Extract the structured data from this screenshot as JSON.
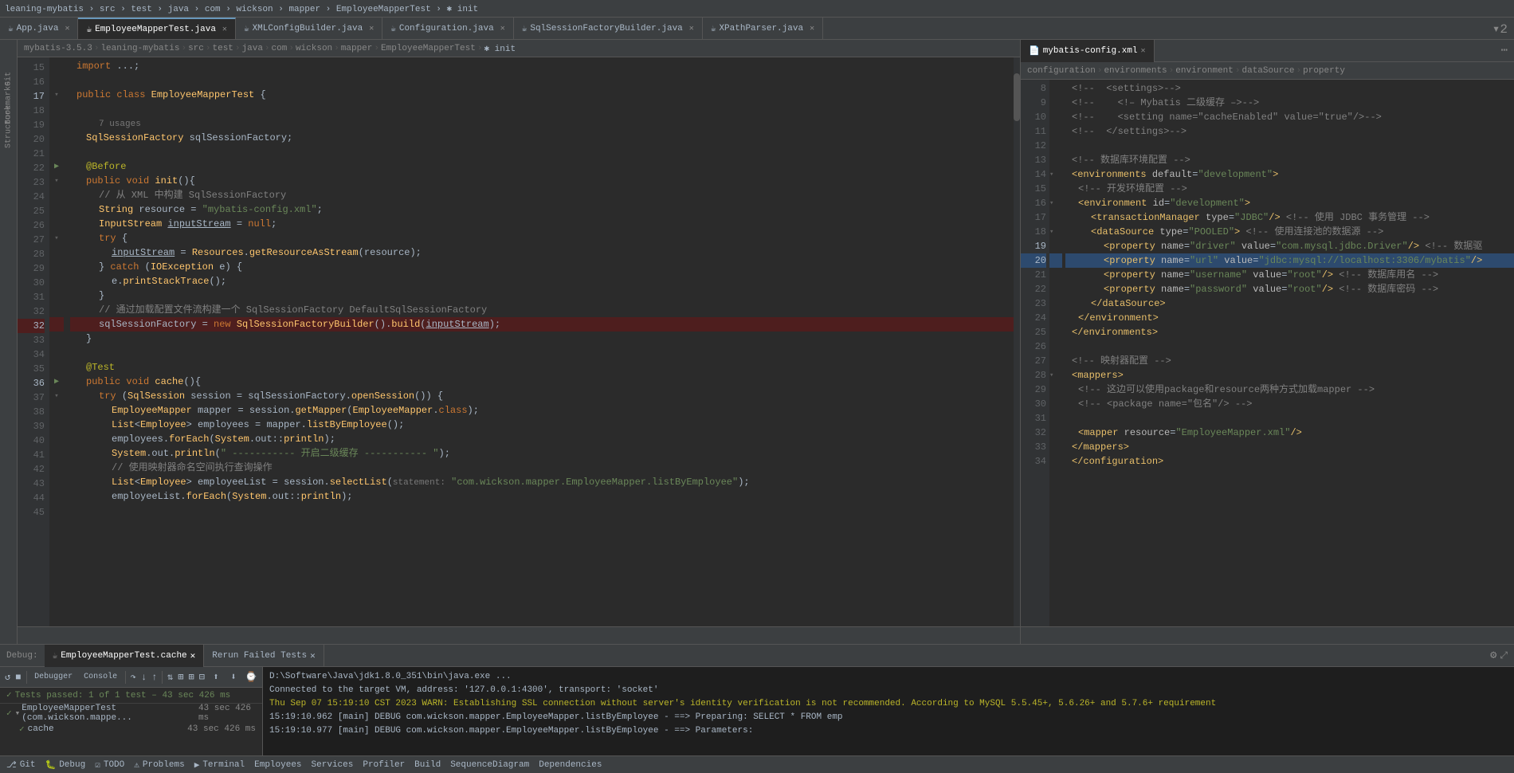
{
  "topbar": {
    "title": "leaning-mybatis",
    "project": "mybatis-3.5.3",
    "separator": "›",
    "path": "leaning-mybatis › src › test › java › com › wickson › mapper › EmployeeMapperTest › ✱ init"
  },
  "tabbar": {
    "tabs": [
      {
        "id": "app",
        "label": "App.java",
        "icon": "☕",
        "active": false
      },
      {
        "id": "employee-mapper-test",
        "label": "EmployeeMapperTest.java",
        "icon": "☕",
        "active": true
      },
      {
        "id": "xml-config-builder",
        "label": "XMLConfigBuilder.java",
        "icon": "☕",
        "active": false
      },
      {
        "id": "configuration",
        "label": "Configuration.java",
        "icon": "☕",
        "active": false
      },
      {
        "id": "sql-session-factory-builder",
        "label": "SqlSessionFactoryBuilder.java",
        "icon": "☕",
        "active": false
      },
      {
        "id": "xpath-parser",
        "label": "XPathParser.java",
        "icon": "☕",
        "active": false
      }
    ],
    "overflow_count": "2"
  },
  "right_tabs": [
    {
      "id": "mybatis-config",
      "label": "mybatis-config.xml",
      "icon": "📄",
      "active": true
    }
  ],
  "breadcrumb": {
    "items": [
      "mybatis-3.5.3",
      "leaning-mybatis",
      "src",
      "test",
      "java",
      "com",
      "wickson",
      "mapper",
      "EmployeeMapperTest",
      "✱ init"
    ]
  },
  "code": {
    "lines": [
      {
        "num": 15,
        "content": "import ...;",
        "type": "normal"
      },
      {
        "num": 16,
        "content": "",
        "type": "normal"
      },
      {
        "num": 17,
        "content": "public class EmployeeMapperTest {",
        "type": "normal"
      },
      {
        "num": 18,
        "content": "",
        "type": "normal"
      },
      {
        "num": 19,
        "content": "    7 usages",
        "type": "hint"
      },
      {
        "num": 20,
        "content": "    SqlSessionFactory sqlSessionFactory;",
        "type": "normal"
      },
      {
        "num": 21,
        "content": "",
        "type": "normal"
      },
      {
        "num": 22,
        "content": "    @Before",
        "type": "normal"
      },
      {
        "num": 23,
        "content": "    public void init(){",
        "type": "normal"
      },
      {
        "num": 24,
        "content": "        // 从 XML 中构建 SqlSessionFactory",
        "type": "comment"
      },
      {
        "num": 25,
        "content": "        String resource = \"mybatis-config.xml\";",
        "type": "normal"
      },
      {
        "num": 26,
        "content": "        InputStream inputStream = null;",
        "type": "normal"
      },
      {
        "num": 27,
        "content": "        try {",
        "type": "normal"
      },
      {
        "num": 28,
        "content": "            inputStream = Resources.getResourceAsStream(resource);",
        "type": "normal"
      },
      {
        "num": 29,
        "content": "        } catch (IOException e) {",
        "type": "normal"
      },
      {
        "num": 30,
        "content": "            e.printStackTrace();",
        "type": "normal"
      },
      {
        "num": 31,
        "content": "        }",
        "type": "normal"
      },
      {
        "num": 32,
        "content": "        // 通过加载配置文件流构建一个 SqlSessionFactory DefaultSqlSessionFactory",
        "type": "comment"
      },
      {
        "num": 33,
        "content": "        sqlSessionFactory = new SqlSessionFactoryBuilder().build(inputStream);",
        "type": "breakpoint"
      },
      {
        "num": 34,
        "content": "    }",
        "type": "normal"
      },
      {
        "num": 35,
        "content": "",
        "type": "normal"
      },
      {
        "num": 36,
        "content": "    @Test",
        "type": "normal"
      },
      {
        "num": 37,
        "content": "    public void cache(){",
        "type": "normal"
      },
      {
        "num": 38,
        "content": "        try (SqlSession session = sqlSessionFactory.openSession()) {",
        "type": "normal"
      },
      {
        "num": 39,
        "content": "            EmployeeMapper mapper = session.getMapper(EmployeeMapper.class);",
        "type": "normal"
      },
      {
        "num": 40,
        "content": "            List<Employee> employees = mapper.listByEmployee();",
        "type": "normal"
      },
      {
        "num": 41,
        "content": "            employees.forEach(System.out::println);",
        "type": "normal"
      },
      {
        "num": 42,
        "content": "            System.out.println(\" ----------- 开启二级缓存 ----------- \");",
        "type": "normal"
      },
      {
        "num": 43,
        "content": "            // 使用映射器命名空间执行查询操作",
        "type": "comment"
      },
      {
        "num": 44,
        "content": "            List<Employee> employeeList = session.selectList( statement: \"com.wickson.mapper.EmployeeMapper.listByEmployee\");",
        "type": "normal"
      },
      {
        "num": 45,
        "content": "            employeeList.forEach(System.out::println);",
        "type": "normal"
      }
    ]
  },
  "xml_code": {
    "lines": [
      {
        "num": 8,
        "content": "    <!--  <settings>-->",
        "type": "comment"
      },
      {
        "num": 9,
        "content": "    <!--    &lt;!&ndash; Mybatis 二级缓存 &ndash;&gt;-->",
        "type": "comment"
      },
      {
        "num": 10,
        "content": "    <!--    <setting name=\"cacheEnabled\" value=\"true\"/>-->",
        "type": "comment"
      },
      {
        "num": 11,
        "content": "    <!--  </settings>-->",
        "type": "comment"
      },
      {
        "num": 12,
        "content": "",
        "type": "normal"
      },
      {
        "num": 13,
        "content": "    <!-- 数据库环境配置 -->",
        "type": "comment"
      },
      {
        "num": 14,
        "content": "    <environments default=\"development\">",
        "type": "normal"
      },
      {
        "num": 15,
        "content": "      <!-- 开发环境配置 -->",
        "type": "comment"
      },
      {
        "num": 16,
        "content": "      <environment id=\"development\">",
        "type": "normal"
      },
      {
        "num": 17,
        "content": "        <transactionManager type=\"JDBC\"/> <!-- 使用 JDBC 事务管理 -->",
        "type": "normal"
      },
      {
        "num": 18,
        "content": "        <dataSource type=\"POOLED\"> <!-- 使用连接池的数据源 -->",
        "type": "normal"
      },
      {
        "num": 19,
        "content": "          <property name=\"driver\" value=\"com.mysql.jdbc.Driver\"/> <!-- 数据驱",
        "type": "normal"
      },
      {
        "num": 20,
        "content": "          <property name=\"url\" value=\"jdbc:mysql://localhost:3306/mybatis\"/>",
        "type": "highlight"
      },
      {
        "num": 21,
        "content": "          <property name=\"username\" value=\"root\"/> <!-- 数据库用名 -->",
        "type": "normal"
      },
      {
        "num": 22,
        "content": "          <property name=\"password\" value=\"root\"/> <!-- 数据库密码 -->",
        "type": "normal"
      },
      {
        "num": 23,
        "content": "        </dataSource>",
        "type": "normal"
      },
      {
        "num": 24,
        "content": "      </environment>",
        "type": "normal"
      },
      {
        "num": 25,
        "content": "    </environments>",
        "type": "normal"
      },
      {
        "num": 26,
        "content": "",
        "type": "normal"
      },
      {
        "num": 27,
        "content": "    <!-- 映射器配置 -->",
        "type": "comment"
      },
      {
        "num": 28,
        "content": "    <mappers>",
        "type": "normal"
      },
      {
        "num": 29,
        "content": "      <!-- 这边可以使用package和resource两种方式加载mapper -->",
        "type": "comment"
      },
      {
        "num": 30,
        "content": "      <!-- <package name=\"包名\"/> -->",
        "type": "comment"
      },
      {
        "num": 31,
        "content": "",
        "type": "normal"
      },
      {
        "num": 32,
        "content": "      <mapper resource=\"EmployeeMapper.xml\"/>",
        "type": "normal"
      },
      {
        "num": 33,
        "content": "    </mappers>",
        "type": "normal"
      },
      {
        "num": 34,
        "content": "  </configuration>",
        "type": "normal"
      }
    ]
  },
  "xml_breadcrumb": {
    "items": [
      "configuration",
      "environments",
      "environment",
      "dataSource",
      "property"
    ]
  },
  "debug": {
    "tabs": [
      {
        "id": "employee-mapper-test",
        "label": "EmployeeMapperTest.cache",
        "active": true
      },
      {
        "id": "rerun-failed",
        "label": "Rerun Failed Tests",
        "active": false
      }
    ],
    "sub_tabs": [
      {
        "id": "debugger",
        "label": "Debugger"
      },
      {
        "id": "console",
        "label": "Console"
      }
    ],
    "test_status": "Tests passed: 1 of 1 test – 43 sec 426 ms",
    "tree": [
      {
        "id": "employee-mapper-test-class",
        "label": "EmployeeMapperTest (com.wickson.mappe...",
        "time": "43 sec 426 ms",
        "check": "✓",
        "expanded": true
      },
      {
        "id": "cache-method",
        "label": "cache",
        "time": "43 sec 426 ms",
        "check": "✓",
        "expanded": false,
        "indent": 20
      }
    ],
    "console_lines": [
      {
        "text": "D:\\Software\\Java\\jdk1.8.0_351\\bin\\java.exe ...",
        "type": "normal"
      },
      {
        "text": "Connected to the target VM, address: '127.0.0.1:4300', transport: 'socket'",
        "type": "normal"
      },
      {
        "text": "Thu Sep 07 15:19:10 CST 2023 WARN: Establishing SSL connection without server's identity verification is not recommended. According to MySQL 5.5.45+, 5.6.26+ and 5.7.6+ requirement",
        "type": "warn"
      },
      {
        "text": "15:19:10.962 [main] DEBUG com.wickson.mapper.EmployeeMapper.listByEmployee - ==>  Preparing: SELECT * FROM emp",
        "type": "debug"
      },
      {
        "text": "15:19:10.977 [main] DEBUG com.wickson.mapper.EmployeeMapper.listByEmployee - ==> Parameters:",
        "type": "debug"
      }
    ]
  },
  "statusbar": {
    "items": [
      {
        "id": "git",
        "label": "Git",
        "icon": "⎇"
      },
      {
        "id": "debug",
        "label": "Debug",
        "icon": "🐛"
      },
      {
        "id": "todo",
        "label": "TODO",
        "icon": "☑"
      },
      {
        "id": "problems",
        "label": "Problems",
        "icon": "⚠"
      },
      {
        "id": "terminal",
        "label": "Terminal",
        "icon": "▶"
      },
      {
        "id": "employees",
        "label": "Employees",
        "icon": "👤"
      },
      {
        "id": "services",
        "label": "Services",
        "icon": "⚙"
      },
      {
        "id": "profiler",
        "label": "Profiler",
        "icon": "📊"
      },
      {
        "id": "build",
        "label": "Build",
        "icon": "🔨"
      },
      {
        "id": "sequence",
        "label": "SequenceDiagram",
        "icon": "📋"
      },
      {
        "id": "dependencies",
        "label": "Dependencies",
        "icon": "📦"
      }
    ]
  }
}
